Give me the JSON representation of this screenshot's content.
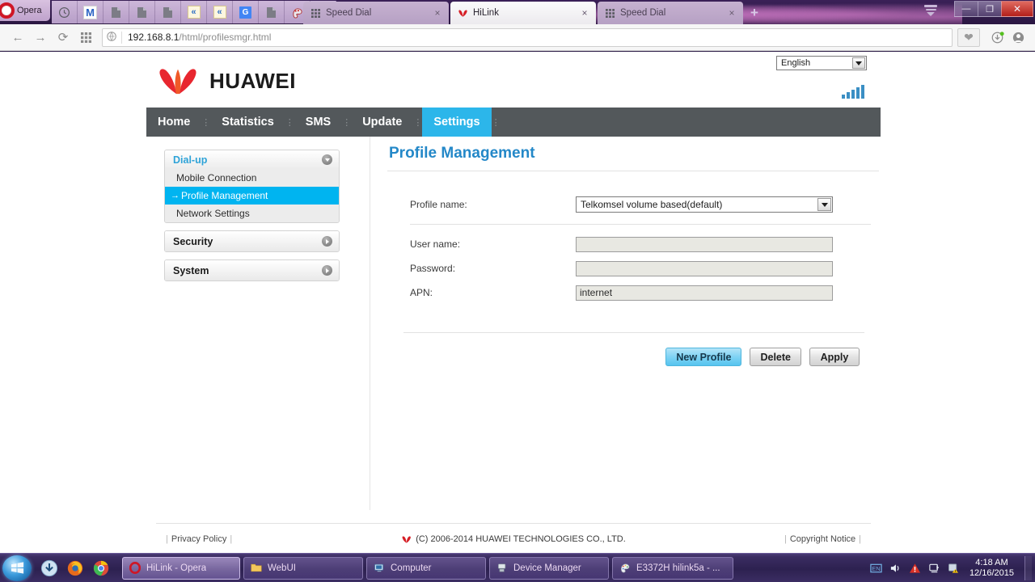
{
  "browser": {
    "app_button": "Opera",
    "pinned_icons": [
      "clock-icon",
      "gmail-icon",
      "document-icon",
      "document-icon",
      "document-icon",
      "prev-icon",
      "prev-icon",
      "google-translate-icon",
      "document-icon",
      "paint-icon",
      "r-icon"
    ],
    "tabs": [
      {
        "title": "Speed Dial",
        "favicon": "speeddial-icon",
        "active": false,
        "close": "×"
      },
      {
        "title": "HiLink",
        "favicon": "huawei-icon",
        "active": true,
        "close": "×"
      },
      {
        "title": "Speed Dial",
        "favicon": "speeddial-icon",
        "active": false,
        "close": "×"
      }
    ],
    "new_tab_label": "+",
    "window_controls": {
      "minimize": "—",
      "maximize": "❐",
      "close": "✕"
    },
    "nav": {
      "back": "←",
      "forward": "→",
      "reload": "⟳",
      "speed_dial": "speed-dial-icon"
    },
    "address": {
      "host": "192.168.8.1",
      "path": "/html/profilesmgr.html",
      "full": "192.168.8.1/html/profilesmgr.html"
    },
    "right_icons": [
      "heart-icon",
      "downloads-icon",
      "account-icon"
    ]
  },
  "webui": {
    "language": {
      "selected": "English",
      "options": [
        "English"
      ]
    },
    "brand": "HUAWEI",
    "signal": {
      "icon": "signal-bars-icon",
      "bars": 5,
      "active_bars": 5,
      "color": "#3b8fc4"
    },
    "nav_items": [
      {
        "label": "Home",
        "active": false
      },
      {
        "label": "Statistics",
        "active": false
      },
      {
        "label": "SMS",
        "active": false
      },
      {
        "label": "Update",
        "active": false
      },
      {
        "label": "Settings",
        "active": true
      }
    ],
    "sidebar": [
      {
        "label": "Dial-up",
        "expanded": true,
        "children": [
          {
            "label": "Mobile Connection",
            "selected": false
          },
          {
            "label": "Profile Management",
            "selected": true
          },
          {
            "label": "Network Settings",
            "selected": false
          }
        ]
      },
      {
        "label": "Security",
        "expanded": false,
        "children": []
      },
      {
        "label": "System",
        "expanded": false,
        "children": []
      }
    ],
    "page_title": "Profile Management",
    "form": {
      "profile_name": {
        "label": "Profile name:",
        "value": "Telkomsel volume based(default)",
        "options": [
          "Telkomsel volume based(default)"
        ]
      },
      "user_name": {
        "label": "User name:",
        "value": "",
        "placeholder": ""
      },
      "password": {
        "label": "Password:",
        "value": "",
        "placeholder": ""
      },
      "apn": {
        "label": "APN:",
        "value": "internet",
        "placeholder": ""
      }
    },
    "buttons": [
      {
        "label": "New Profile",
        "primary": true
      },
      {
        "label": "Delete",
        "primary": false
      },
      {
        "label": "Apply",
        "primary": false
      }
    ],
    "footer": {
      "privacy": "Privacy Policy",
      "copyright": "(C) 2006-2014 HUAWEI TECHNOLOGIES CO., LTD.",
      "notice": "Copyright Notice"
    }
  },
  "taskbar": {
    "start": "start-orb-icon",
    "quick_launch": [
      "download-manager-icon",
      "firefox-icon",
      "chrome-icon"
    ],
    "tasks": [
      {
        "label": "HiLink - Opera",
        "icon": "opera-icon",
        "active": true
      },
      {
        "label": "WebUI",
        "icon": "folder-icon",
        "active": false
      },
      {
        "label": "Computer",
        "icon": "computer-icon",
        "active": false
      },
      {
        "label": "Device Manager",
        "icon": "device-manager-icon",
        "active": false
      },
      {
        "label": "E3372H hilink5a - ...",
        "icon": "paint-icon",
        "active": false
      }
    ],
    "tray_icons": [
      "language-bar-icon",
      "volume-icon",
      "action-center-warning-icon",
      "network-icon",
      "flag-warning-icon"
    ],
    "clock": {
      "time": "4:18 AM",
      "date": "12/16/2015"
    }
  }
}
